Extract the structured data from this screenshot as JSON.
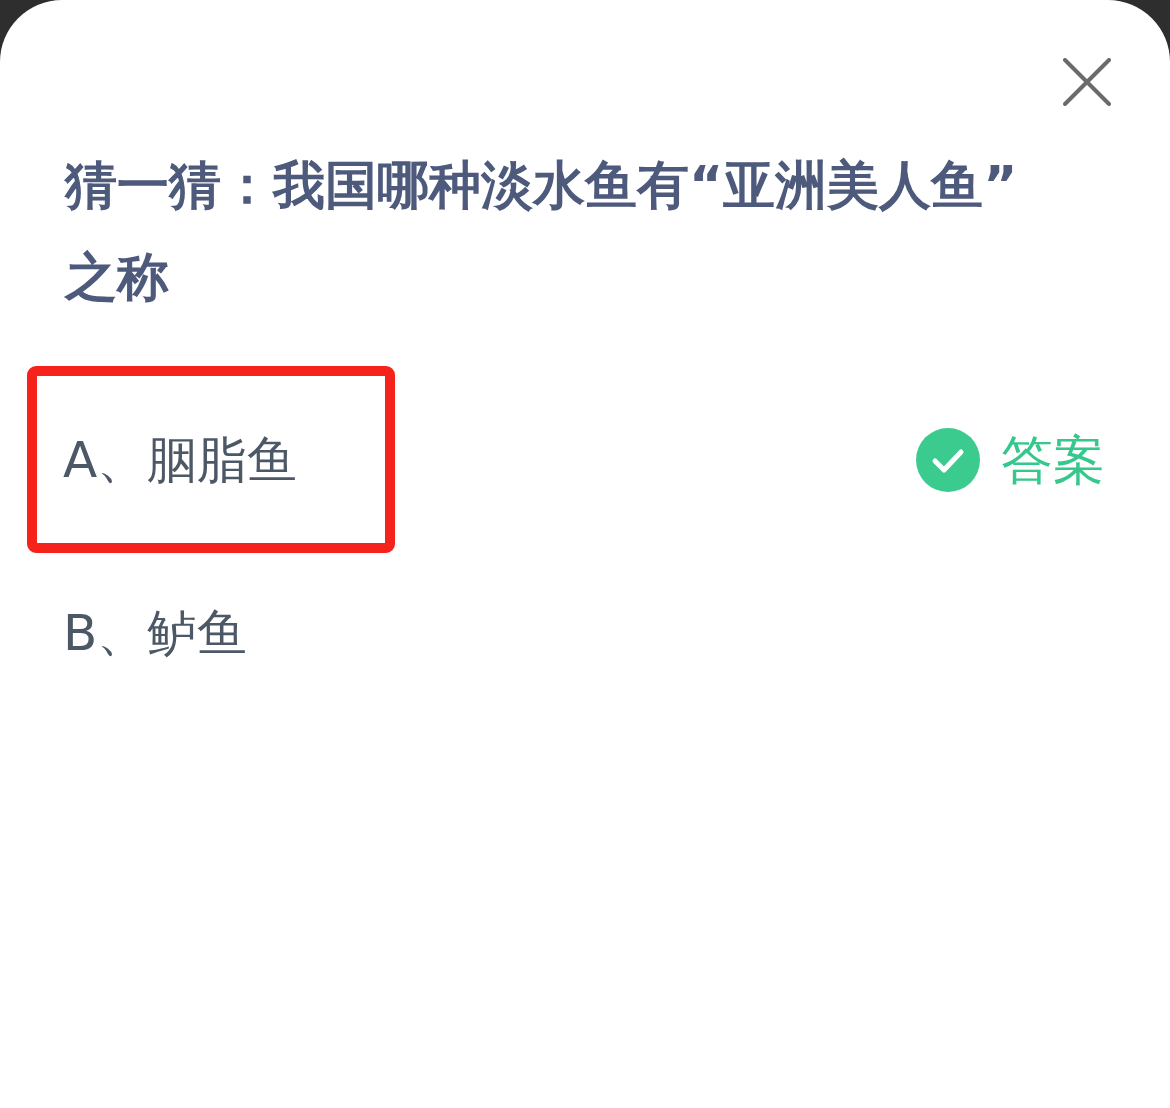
{
  "question": "猜一猜：我国哪种淡水鱼有“亚洲美人鱼”之称",
  "options": [
    {
      "label": "A、胭脂鱼",
      "highlighted": true,
      "is_answer": true,
      "answer_label": "答案"
    },
    {
      "label": "B、鲈鱼",
      "highlighted": false,
      "is_answer": false
    }
  ]
}
